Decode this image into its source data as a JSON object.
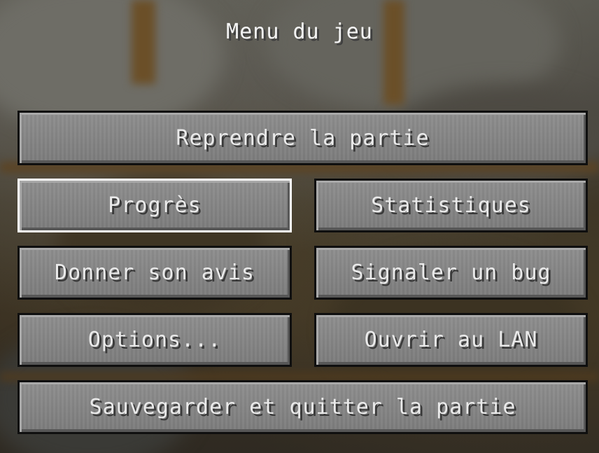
{
  "menu": {
    "title": "Menu du jeu",
    "buttons": {
      "resume": "Reprendre la partie",
      "advancements": "Progrès",
      "statistics": "Statistiques",
      "feedback": "Donner son avis",
      "report_bug": "Signaler un bug",
      "options": "Options...",
      "open_lan": "Ouvrir au LAN",
      "save_quit": "Sauvegarder et quitter la partie"
    },
    "selected": "advancements"
  },
  "colors": {
    "button_face": "#7c7c7c",
    "button_border": "#0f0f0f",
    "selected_border": "#ffffff",
    "text": "#eaeaea"
  }
}
